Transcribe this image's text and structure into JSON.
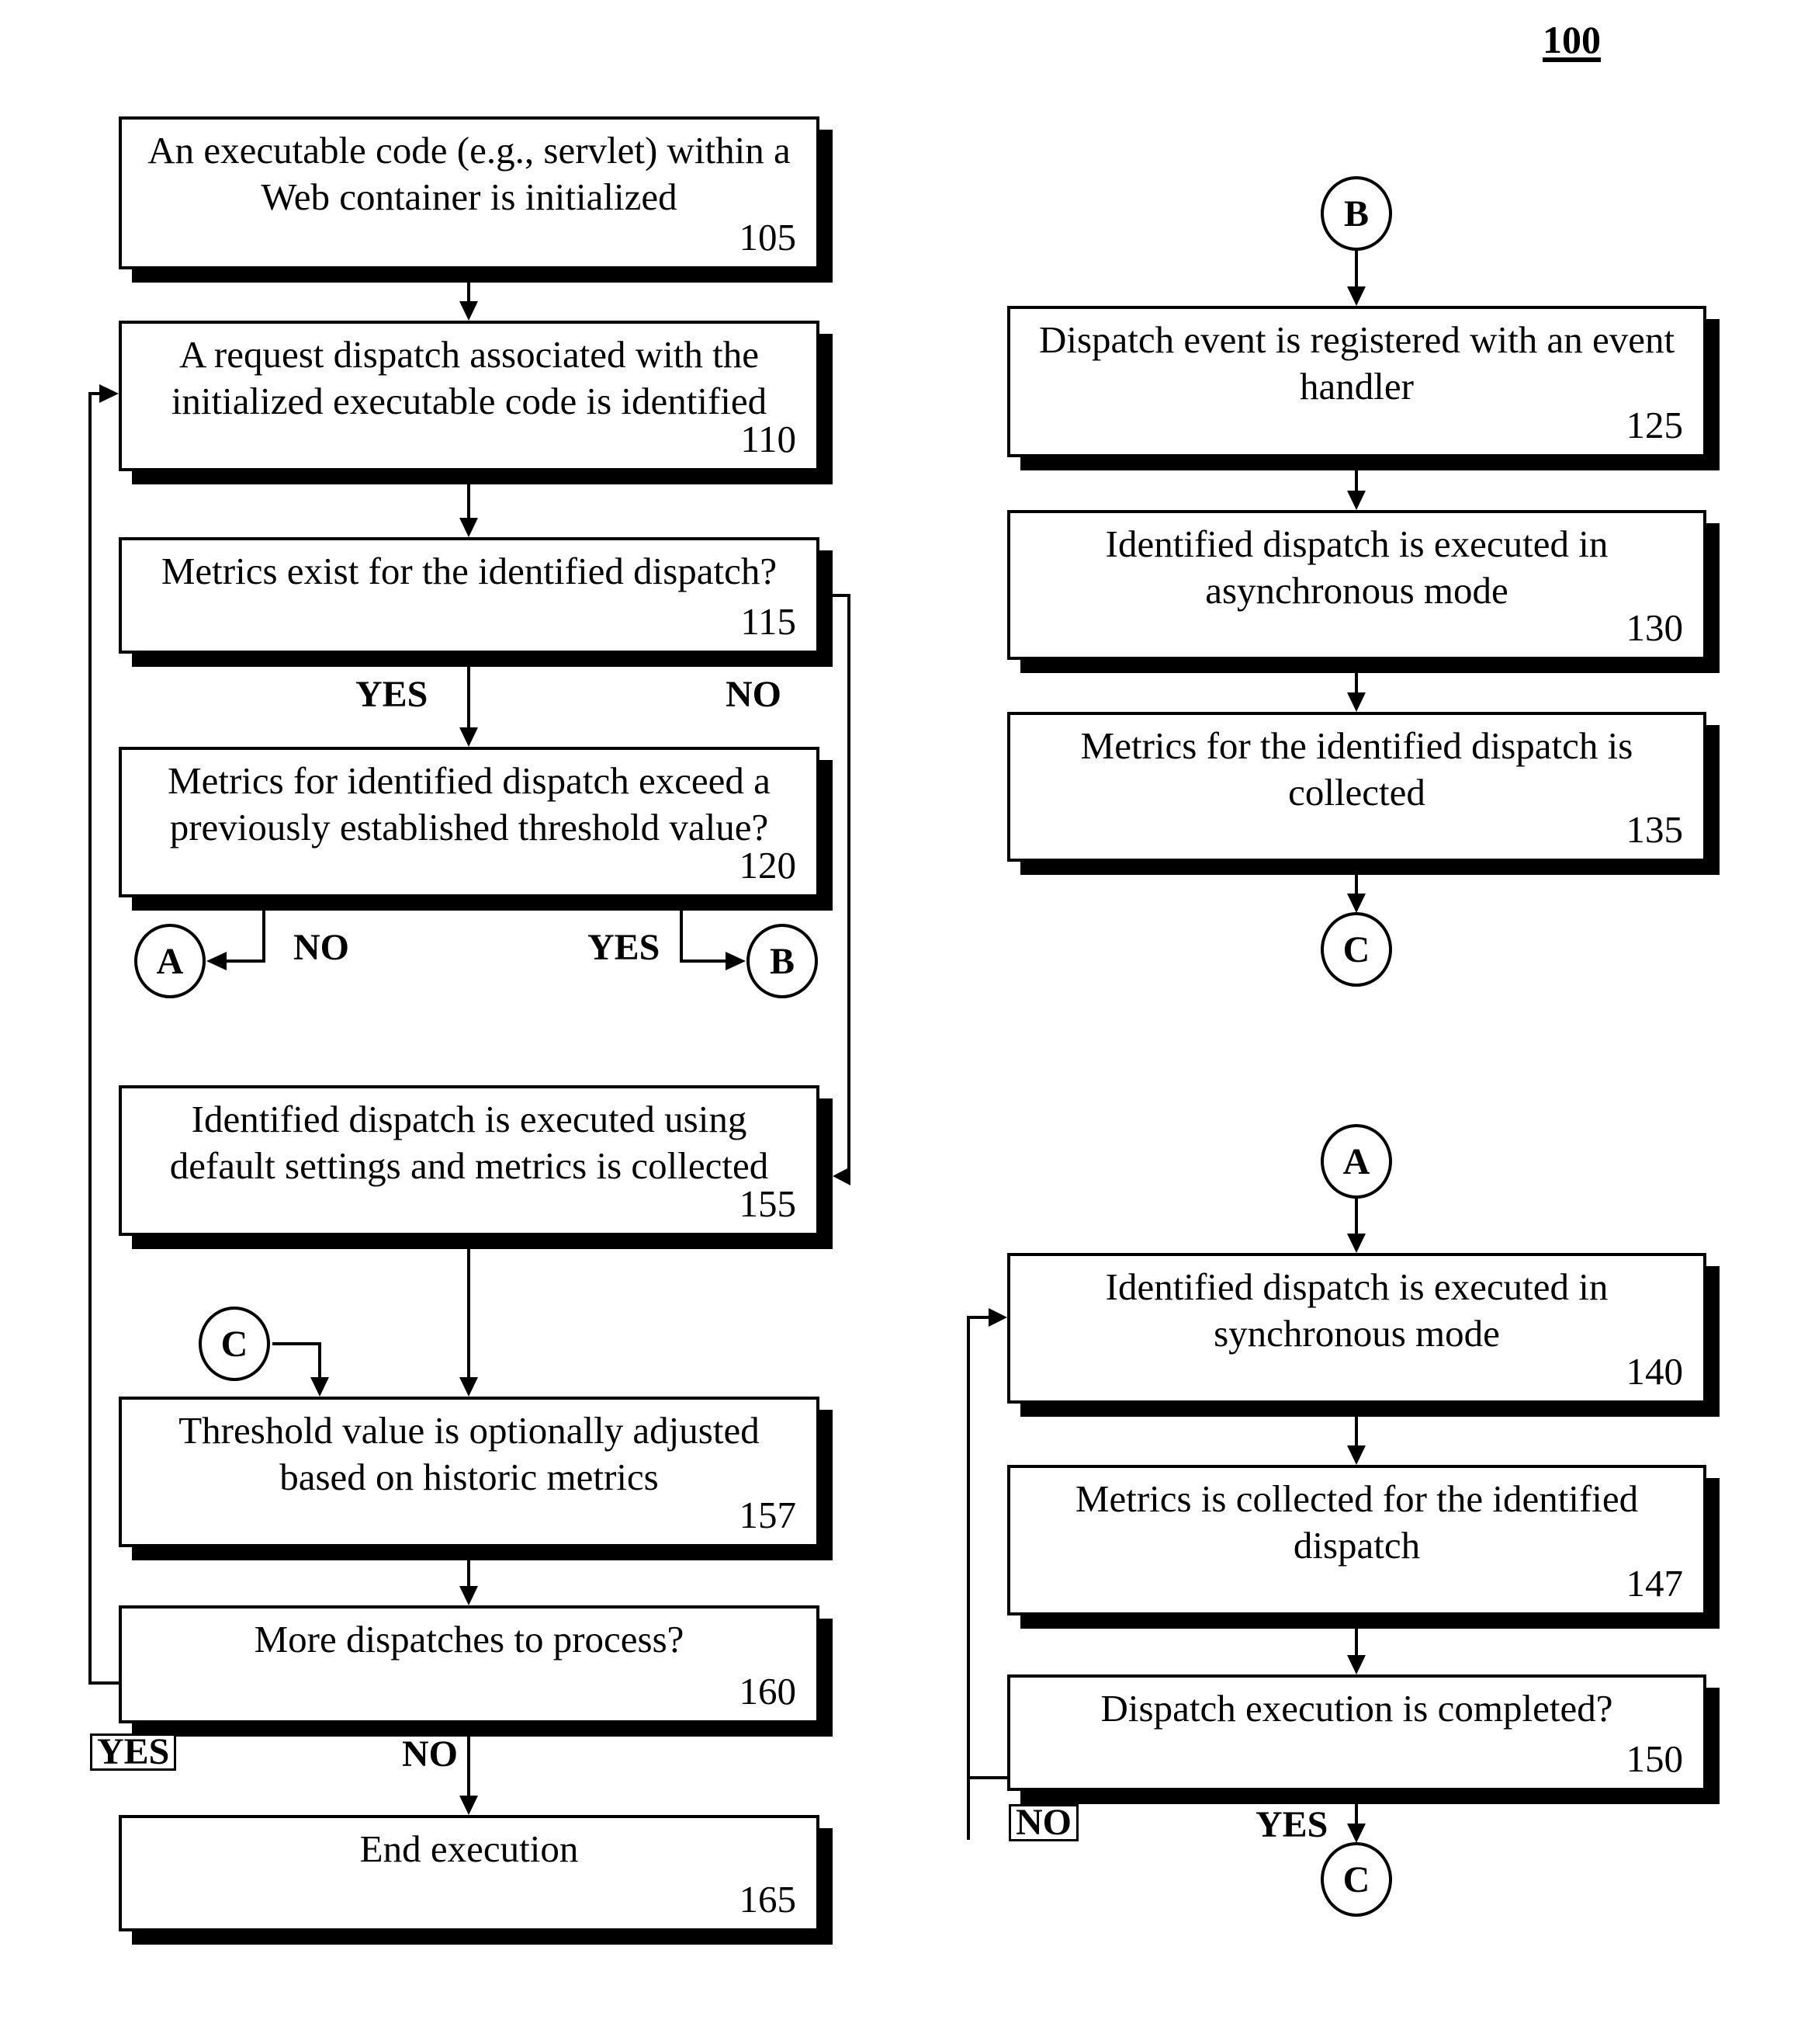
{
  "figure_label": "100",
  "steps": {
    "s105": {
      "text": "An executable code (e.g., servlet) within a Web container is initialized",
      "number": "105"
    },
    "s110": {
      "text": "A request dispatch associated with the initialized executable code is identified",
      "number": "110"
    },
    "s115": {
      "text": "Metrics exist for the identified dispatch?",
      "number": "115"
    },
    "s120": {
      "text": "Metrics for identified dispatch exceed a previously established threshold value?",
      "number": "120"
    },
    "s155": {
      "text": "Identified dispatch is executed using default settings and metrics is collected",
      "number": "155"
    },
    "s157": {
      "text": "Threshold value is optionally adjusted based on historic metrics",
      "number": "157"
    },
    "s160": {
      "text": "More dispatches to process?",
      "number": "160"
    },
    "s165": {
      "text": "End execution",
      "number": "165"
    },
    "s125": {
      "text": "Dispatch event is registered with an event handler",
      "number": "125"
    },
    "s130": {
      "text": "Identified dispatch is executed in asynchronous mode",
      "number": "130"
    },
    "s135": {
      "text": "Metrics for the identified dispatch is collected",
      "number": "135"
    },
    "s140": {
      "text": "Identified dispatch is executed in synchronous mode",
      "number": "140"
    },
    "s147": {
      "text": "Metrics is collected for the identified dispatch",
      "number": "147"
    },
    "s150": {
      "text": "Dispatch execution is completed?",
      "number": "150"
    }
  },
  "connectors": {
    "a_out": "A",
    "b_out": "B",
    "c_in": "C",
    "b_in": "B",
    "c_out_async": "C",
    "a_in": "A",
    "c_out_sync": "C"
  },
  "branch_labels": {
    "s115_yes": "YES",
    "s115_no": "NO",
    "s120_no": "NO",
    "s120_yes": "YES",
    "s160_yes": "YES",
    "s160_no": "NO",
    "s150_no": "NO",
    "s150_yes": "YES"
  }
}
